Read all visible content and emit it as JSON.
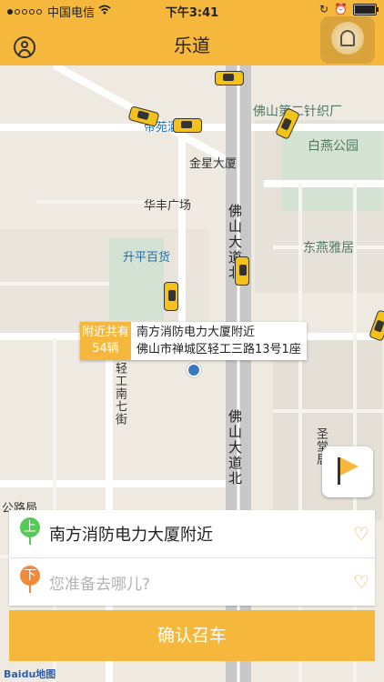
{
  "status_bar": {
    "carrier": "中国电信",
    "time": "下午3:41",
    "signal_icon": "signal-dots-icon",
    "wifi_icon": "wifi-icon",
    "battery_icon": "battery-icon"
  },
  "nav": {
    "title": "乐道",
    "profile_icon": "user-icon",
    "bell_icon": "bell-icon"
  },
  "map": {
    "place_labels": [
      "佛山第二针织厂",
      "白燕公园",
      "金星大厦",
      "华丰广场",
      "升平百货",
      "东燕雅居",
      "帝苑酒店",
      "圣堂居",
      "公路局",
      "轻工南七街"
    ],
    "road_labels": [
      "佛山大道北",
      "佛山大道北"
    ],
    "nearby_callout": {
      "line1": "附近共有",
      "line2": "54辆"
    },
    "location_callout": {
      "name": "南方消防电力大厦附近",
      "address": "佛山市禅城区轻工三路13号1座"
    },
    "flag_icon": "flag-icon",
    "location_pin_icon": "location-pin-icon",
    "watermark": "Baidu地图"
  },
  "trip": {
    "pickup_marker": "上",
    "pickup": "南方消防电力大厦附近",
    "dest_marker": "下",
    "dest_placeholder": "您准备去哪儿?",
    "heart_icon": "heart-icon"
  },
  "confirm_label": "确认召车",
  "colors": {
    "accent": "#f5b83d",
    "pickup_green": "#57c957",
    "dest_orange": "#f08a3b"
  }
}
